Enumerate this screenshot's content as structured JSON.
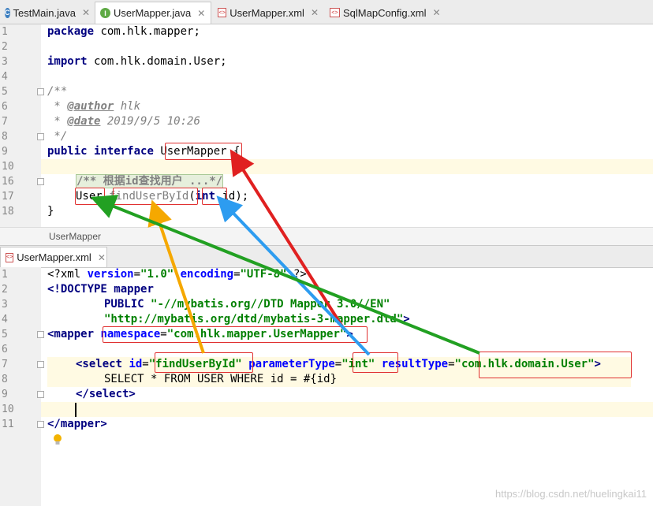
{
  "top_tabs": [
    {
      "label": "TestMain.java",
      "icon": "class-icon"
    },
    {
      "label": "UserMapper.java",
      "icon": "interface-icon"
    },
    {
      "label": "UserMapper.xml",
      "icon": "xml-icon"
    },
    {
      "label": "SqlMapConfig.xml",
      "icon": "xml-icon"
    }
  ],
  "java_editor": {
    "line_numbers": [
      "1",
      "2",
      "3",
      "4",
      "5",
      "6",
      "7",
      "8",
      "9",
      "10",
      "16",
      "17",
      "18"
    ],
    "package_kw": "package",
    "package_name": " com.hlk.mapper;",
    "import_kw": "import",
    "import_name": " com.hlk.domain.User;",
    "doc_open": "/**",
    "author_prefix": " * ",
    "author_tag": "@author",
    "author_val": " hlk",
    "date_prefix": " * ",
    "date_tag": "@date",
    "date_val": " 2019/9/5 10:26",
    "doc_close": " */",
    "public_kw": "public",
    "interface_kw": "interface",
    "interface_name": "UserMapper",
    "brace_open": " {",
    "folded_comment": "/** 根据id查找用户 ...*/",
    "return_type": "User",
    "method_name": "findUserById",
    "paren_open": "(",
    "param_type": "int",
    "param_rest": " id);",
    "brace_close": "}"
  },
  "breadcrumb": "UserMapper",
  "xml_tab": {
    "label": "UserMapper.xml",
    "icon": "xml-icon"
  },
  "xml_editor": {
    "line_numbers": [
      "1",
      "2",
      "3",
      "4",
      "5",
      "6",
      "7",
      "8",
      "9",
      "10",
      "11"
    ],
    "l1_a": "<?xml ",
    "l1_version_attr": "version",
    "l1_version_val": "\"1.0\"",
    "l1_enc_attr": "encoding",
    "l1_enc_val": "\"UTF-8\"",
    "l1_end": "?>",
    "l2_a": "<!DOCTYPE ",
    "l2_b": "mapper",
    "l3_public": "PUBLIC ",
    "l3_val": "\"-//mybatis.org//DTD Mapper 3.0//EN\"",
    "l4_val": "\"http://mybatis.org/dtd/mybatis-3-mapper.dtd\"",
    "l4_end": ">",
    "l5_tag": "<mapper ",
    "l5_attr": "namespace",
    "l5_val": "\"com.hlk.mapper.UserMapper\"",
    "l5_end": ">",
    "l7_tag": "<select ",
    "l7_id_attr": "id",
    "l7_id_val": "\"findUserById\"",
    "l7_pt_attr": "parameterType",
    "l7_pt_val": "\"int\"",
    "l7_rt_attr": "resultType",
    "l7_rt_val": "\"com.hlk.domain.User\"",
    "l7_end": ">",
    "l8_sql": "SELECT * FROM USER WHERE id = #{id}",
    "l9_tag": "</select>",
    "l11_tag": "</mapper>"
  },
  "watermark": "https://blog.csdn.net/huelingkai11",
  "colors": {
    "keyword": "#000080",
    "string": "#008000",
    "attribute": "#0000ff",
    "comment": "#808080",
    "arrow_red": "#e02020",
    "arrow_orange": "#f5a800",
    "arrow_blue": "#2d9cf0",
    "arrow_green": "#22a022"
  }
}
